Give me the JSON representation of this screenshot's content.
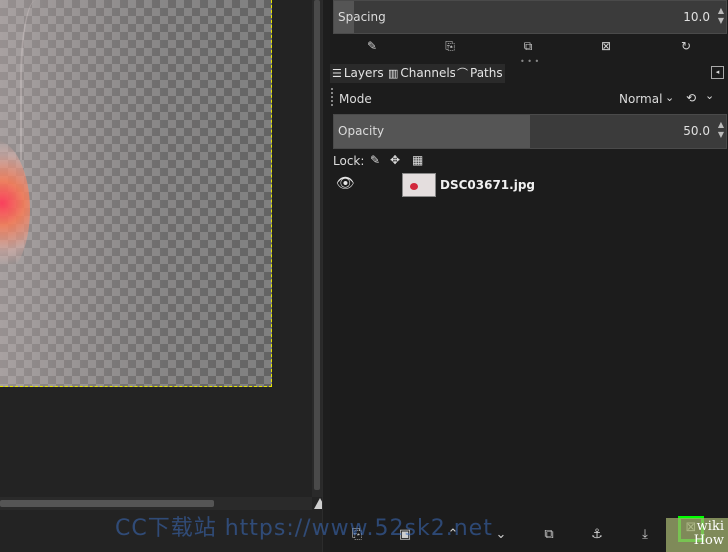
{
  "tool_options": {
    "spacing_label": "Spacing",
    "spacing_value": "10.0",
    "spacing_fraction": 0.05
  },
  "tabs": [
    {
      "label": "Layers",
      "icon": "layers-icon"
    },
    {
      "label": "Channels",
      "icon": "channels-icon"
    },
    {
      "label": "Paths",
      "icon": "paths-icon"
    }
  ],
  "layers_panel": {
    "mode_label": "Mode",
    "mode_value": "Normal",
    "opacity_label": "Opacity",
    "opacity_value": "50.0",
    "opacity_fraction": 0.5,
    "lock_label": "Lock:",
    "layers": [
      {
        "name": "DSC03671.jpg",
        "visible": true
      }
    ]
  },
  "watermark": "CC下载站 https://www.52sk2.net",
  "badge": {
    "line1": "wiki",
    "line2": "How"
  },
  "colors": {
    "highlight": "#00ff00",
    "layer_boundary": "#e6e600"
  }
}
